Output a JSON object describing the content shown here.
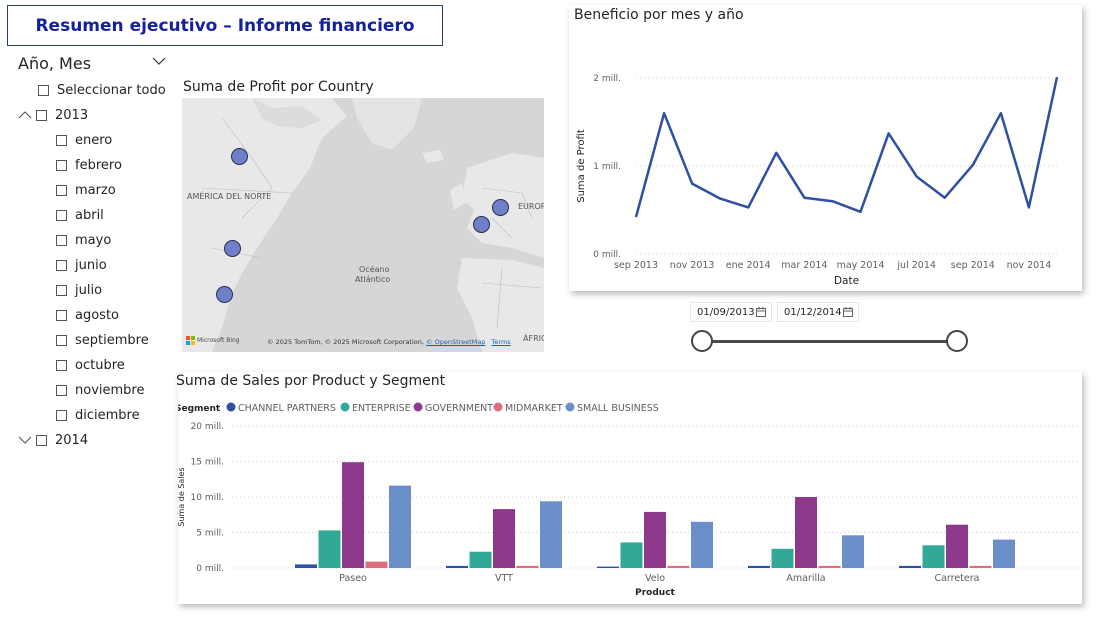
{
  "page": {
    "title": "Resumen ejecutivo – Informe financiero"
  },
  "slicer": {
    "header": "Año, Mes",
    "select_all": "Seleccionar todo",
    "years": [
      {
        "label": "2013",
        "expanded": true,
        "months": [
          "enero",
          "febrero",
          "marzo",
          "abril",
          "mayo",
          "junio",
          "julio",
          "agosto",
          "septiembre",
          "octubre",
          "noviembre",
          "diciembre"
        ]
      },
      {
        "label": "2014",
        "expanded": false,
        "months": []
      }
    ]
  },
  "map": {
    "title": "Suma de Profit por Country",
    "labels": {
      "na": "AMÉRICA DEL NORTE",
      "eu": "EUROP",
      "af": "ÁFRIC",
      "ocean1": "Océano",
      "ocean2": "Atlántico"
    },
    "bing": "Microsoft Bing",
    "attribution": "© 2025 TomTom, © 2025 Microsoft Corporation,",
    "osm": "© OpenStreetMap",
    "terms": "Terms",
    "point_color": "#6f7fc9"
  },
  "line_chart": {
    "title": "Beneficio por mes y año",
    "chart_data": {
      "type": "line",
      "xlabel": "Date",
      "ylabel": "Suma de Profit",
      "x_ticks": [
        "sep 2013",
        "nov 2013",
        "ene 2014",
        "mar 2014",
        "may 2014",
        "jul 2014",
        "sep 2014",
        "nov 2014"
      ],
      "y_ticks": [
        "0 mill.",
        "1 mill.",
        "2 mill."
      ],
      "ylim": [
        0,
        2000000
      ],
      "color": "#2f4fa2",
      "x": [
        "2013-09",
        "2013-10",
        "2013-11",
        "2013-12",
        "2014-01",
        "2014-02",
        "2014-03",
        "2014-04",
        "2014-05",
        "2014-06",
        "2014-07",
        "2014-08",
        "2014-09",
        "2014-10",
        "2014-11",
        "2014-12"
      ],
      "values": [
        420000,
        1600000,
        800000,
        630000,
        530000,
        1150000,
        640000,
        600000,
        480000,
        1370000,
        880000,
        640000,
        1010000,
        1600000,
        530000,
        2010000
      ]
    }
  },
  "date_slicer": {
    "start": "01/09/2013",
    "end": "01/12/2014"
  },
  "bar_chart": {
    "title": "Suma de Sales por Product y Segment",
    "chart_data": {
      "type": "bar",
      "legend_title": "Segment",
      "xlabel": "Product",
      "ylabel": "Suma de Sales",
      "categories": [
        "Paseo",
        "VTT",
        "Velo",
        "Amarilla",
        "Carretera"
      ],
      "y_ticks": [
        "0 mill.",
        "5 mill.",
        "10 mill.",
        "15 mill.",
        "20 mill."
      ],
      "ylim": [
        0,
        20000000
      ],
      "series": [
        {
          "name": "CHANNEL PARTNERS",
          "color": "#2f4fa2",
          "values": [
            500000,
            300000,
            200000,
            300000,
            300000
          ]
        },
        {
          "name": "ENTERPRISE",
          "color": "#32a897",
          "values": [
            5300000,
            2300000,
            3600000,
            2700000,
            3200000
          ]
        },
        {
          "name": "GOVERNMENT",
          "color": "#8e3a8c",
          "values": [
            14900000,
            8300000,
            7900000,
            10000000,
            6100000
          ]
        },
        {
          "name": "MIDMARKET",
          "color": "#e06c7f",
          "values": [
            900000,
            300000,
            300000,
            300000,
            300000
          ]
        },
        {
          "name": "SMALL BUSINESS",
          "color": "#6b8fc9",
          "values": [
            11600000,
            9400000,
            6500000,
            4600000,
            4000000
          ]
        }
      ]
    }
  }
}
